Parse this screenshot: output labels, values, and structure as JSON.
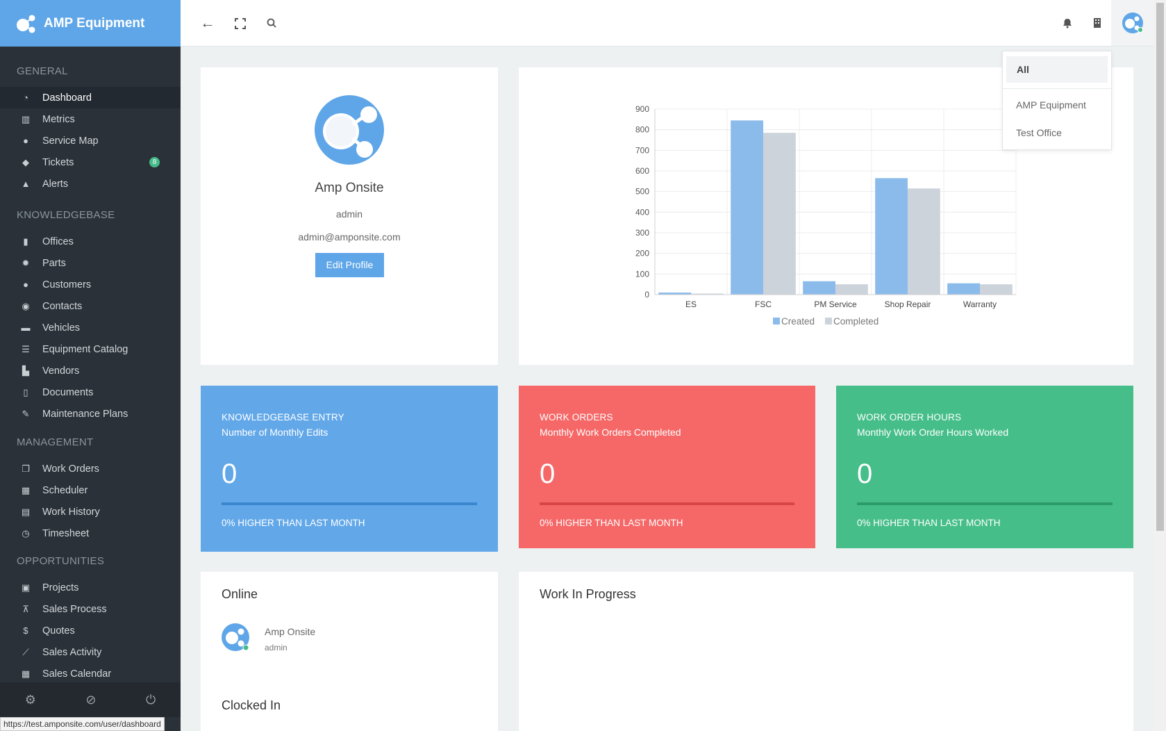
{
  "brand": {
    "name": "AMP Equipment"
  },
  "sidebar": {
    "sections": [
      {
        "title": "GENERAL",
        "items": [
          {
            "label": "Dashboard",
            "icon": "dashboard-icon",
            "active": true
          },
          {
            "label": "Metrics",
            "icon": "bar-chart-icon"
          },
          {
            "label": "Service Map",
            "icon": "map-marker-icon"
          },
          {
            "label": "Tickets",
            "icon": "tag-icon",
            "badge": "8"
          },
          {
            "label": "Alerts",
            "icon": "warning-icon"
          }
        ]
      },
      {
        "title": "KNOWLEDGEBASE",
        "items": [
          {
            "label": "Offices",
            "icon": "building-icon"
          },
          {
            "label": "Parts",
            "icon": "gears-icon"
          },
          {
            "label": "Customers",
            "icon": "users-icon"
          },
          {
            "label": "Contacts",
            "icon": "user-circle-icon"
          },
          {
            "label": "Vehicles",
            "icon": "truck-icon"
          },
          {
            "label": "Equipment Catalog",
            "icon": "list-icon"
          },
          {
            "label": "Vendors",
            "icon": "cart-icon"
          },
          {
            "label": "Documents",
            "icon": "file-icon"
          },
          {
            "label": "Maintenance Plans",
            "icon": "wrench-icon"
          }
        ]
      },
      {
        "title": "MANAGEMENT",
        "items": [
          {
            "label": "Work Orders",
            "icon": "copy-icon"
          },
          {
            "label": "Scheduler",
            "icon": "calendar-icon"
          },
          {
            "label": "Work History",
            "icon": "calendar-check-icon"
          },
          {
            "label": "Timesheet",
            "icon": "clock-icon"
          }
        ]
      },
      {
        "title": "OPPORTUNITIES",
        "items": [
          {
            "label": "Projects",
            "icon": "clipboard-icon"
          },
          {
            "label": "Sales Process",
            "icon": "sitemap-icon"
          },
          {
            "label": "Quotes",
            "icon": "dollar-icon"
          },
          {
            "label": "Sales Activity",
            "icon": "line-chart-icon"
          },
          {
            "label": "Sales Calendar",
            "icon": "calendar-icon"
          }
        ]
      }
    ]
  },
  "profile": {
    "name": "Amp Onsite",
    "role": "admin",
    "email": "admin@amponsite.com",
    "edit_label": "Edit Profile"
  },
  "dropdown": {
    "selected": "All",
    "options": [
      "AMP Equipment",
      "Test Office"
    ]
  },
  "stats": [
    {
      "title": "KNOWLEDGEBASE ENTRY",
      "subtitle": "Number of Monthly Edits",
      "value": "0",
      "footer": "0% HIGHER THAN LAST MONTH",
      "color": "#62a8e9",
      "bar": "#3a86cf"
    },
    {
      "title": "WORK ORDERS",
      "subtitle": "Monthly Work Orders Completed",
      "value": "0",
      "footer": "0% HIGHER THAN LAST MONTH",
      "color": "#f66868",
      "bar": "#d94545"
    },
    {
      "title": "WORK ORDER HOURS",
      "subtitle": "Monthly Work Order Hours Worked",
      "value": "0",
      "footer": "0% HIGHER THAN LAST MONTH",
      "color": "#46be89",
      "bar": "#2b9b6a"
    }
  ],
  "online": {
    "title": "Online",
    "user_name": "Amp Onsite",
    "user_role": "admin",
    "clocked_in_title": "Clocked In"
  },
  "wip": {
    "title": "Work In Progress"
  },
  "status_url": "https://test.amponsite.com/user/dashboard",
  "chart_data": {
    "type": "bar",
    "categories": [
      "ES",
      "FSC",
      "PM Service",
      "Shop Repair",
      "Warranty"
    ],
    "series": [
      {
        "name": "Created",
        "values": [
          10,
          845,
          65,
          565,
          55
        ],
        "color": "#8bbbeb"
      },
      {
        "name": "Completed",
        "values": [
          5,
          785,
          50,
          515,
          50
        ],
        "color": "#ccd3db"
      }
    ],
    "ylim": [
      0,
      900
    ],
    "yticks": [
      0,
      100,
      200,
      300,
      400,
      500,
      600,
      700,
      800,
      900
    ],
    "legend": "bottom",
    "grid": true
  }
}
